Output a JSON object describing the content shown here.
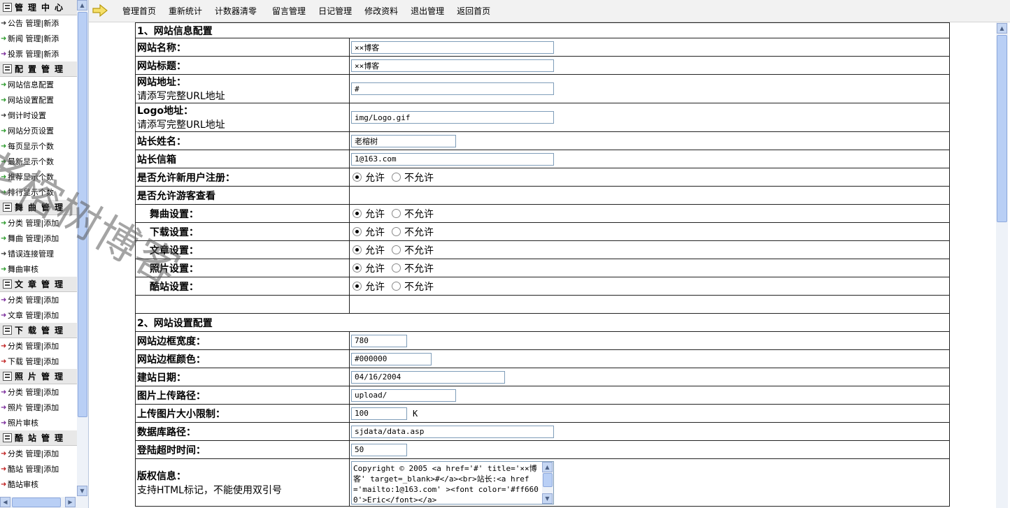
{
  "topbar": {
    "nav": [
      "管理首页",
      "重新统计",
      "计数器清零",
      "留言管理",
      "日记管理",
      "修改资料",
      "退出管理",
      "返回首页"
    ]
  },
  "sidebar": {
    "items": [
      {
        "type": "head",
        "label": "管理中心"
      },
      {
        "type": "item",
        "arrow": "blk",
        "label": "公告 管理|新添"
      },
      {
        "type": "item",
        "arrow": "grn",
        "label": "新闻 管理|新添"
      },
      {
        "type": "item",
        "arrow": "pur",
        "label": "投票 管理|新添"
      },
      {
        "type": "head",
        "label": "配置管理"
      },
      {
        "type": "item",
        "arrow": "grn",
        "label": "网站信息配置"
      },
      {
        "type": "item",
        "arrow": "grn",
        "label": "网站设置配置"
      },
      {
        "type": "item",
        "arrow": "blk",
        "label": "倒计时设置"
      },
      {
        "type": "item",
        "arrow": "grn",
        "label": "网站分页设置"
      },
      {
        "type": "item",
        "arrow": "grn",
        "label": "每页显示个数"
      },
      {
        "type": "item",
        "arrow": "grn",
        "label": "最新显示个数"
      },
      {
        "type": "item",
        "arrow": "grn",
        "label": "推荐显示个数"
      },
      {
        "type": "item",
        "arrow": "grn",
        "label": "排行显示个数"
      },
      {
        "type": "head",
        "label": "舞曲管理"
      },
      {
        "type": "item",
        "arrow": "grn",
        "label": "分类 管理|添加"
      },
      {
        "type": "item",
        "arrow": "grn",
        "label": "舞曲 管理|添加"
      },
      {
        "type": "item",
        "arrow": "blk",
        "label": "错误连接管理"
      },
      {
        "type": "item",
        "arrow": "grn",
        "label": "舞曲审核"
      },
      {
        "type": "head",
        "label": "文章管理"
      },
      {
        "type": "item",
        "arrow": "pur",
        "label": "分类 管理|添加"
      },
      {
        "type": "item",
        "arrow": "pur",
        "label": "文章 管理|添加"
      },
      {
        "type": "head",
        "label": "下载管理"
      },
      {
        "type": "item",
        "arrow": "red",
        "label": "分类 管理|添加"
      },
      {
        "type": "item",
        "arrow": "red",
        "label": "下载 管理|添加"
      },
      {
        "type": "head",
        "label": "照片管理"
      },
      {
        "type": "item",
        "arrow": "pur",
        "label": "分类 管理|添加"
      },
      {
        "type": "item",
        "arrow": "pur",
        "label": "照片 管理|添加"
      },
      {
        "type": "item",
        "arrow": "pur",
        "label": "照片审核"
      },
      {
        "type": "head",
        "label": "酷站管理"
      },
      {
        "type": "item",
        "arrow": "red",
        "label": "分类 管理|添加"
      },
      {
        "type": "item",
        "arrow": "red",
        "label": "酷站 管理|添加"
      },
      {
        "type": "item",
        "arrow": "red",
        "label": "酷站审核"
      }
    ]
  },
  "watermark": "老榕树博客",
  "form": {
    "rows": [
      {
        "type": "section",
        "label": "1、网站信息配置",
        "h": 22
      },
      {
        "type": "text",
        "label": "网站名称：",
        "value": "××博客",
        "w": 290,
        "h": 26
      },
      {
        "type": "text",
        "label": "网站标题：",
        "value": "××博客",
        "w": 290,
        "h": 26
      },
      {
        "type": "text",
        "label": "网站地址：",
        "sub": "请添写完整URL地址",
        "value": "#",
        "w": 290,
        "h": 41
      },
      {
        "type": "text",
        "label": "Logo地址：",
        "sub": "请添写完整URL地址",
        "value": "img/Logo.gif",
        "w": 290,
        "h": 41
      },
      {
        "type": "text",
        "label": "站长姓名：",
        "value": "老榕树",
        "w": 150,
        "h": 26
      },
      {
        "type": "text",
        "label": "站长信箱",
        "value": "1@163.com",
        "w": 290,
        "h": 26
      },
      {
        "type": "radio",
        "label": "是否允许新用户注册：",
        "checked": 0,
        "h": 26
      },
      {
        "type": "group",
        "label": "是否允许游客查看",
        "h": 26
      },
      {
        "type": "radio",
        "indent": true,
        "label": "舞曲设置：",
        "checked": 0,
        "h": 26
      },
      {
        "type": "radio",
        "indent": true,
        "label": "下载设置：",
        "checked": 0,
        "h": 26
      },
      {
        "type": "radio",
        "indent": true,
        "label": "文章设置：",
        "checked": 0,
        "h": 26
      },
      {
        "type": "radio",
        "indent": true,
        "label": "照片设置：",
        "checked": 0,
        "h": 26
      },
      {
        "type": "radio",
        "indent": true,
        "label": "酷站设置：",
        "checked": 0,
        "h": 26
      },
      {
        "type": "empty",
        "h": 26
      },
      {
        "type": "section",
        "label": "2、网站设置配置",
        "h": 26
      },
      {
        "type": "text",
        "label": "网站边框宽度：",
        "value": "780",
        "w": 80,
        "h": 26
      },
      {
        "type": "text",
        "label": "网站边框颜色：",
        "value": "#000000",
        "w": 115,
        "h": 26
      },
      {
        "type": "text",
        "label": "建站日期：",
        "value": "04/16/2004",
        "w": 220,
        "h": 26
      },
      {
        "type": "text",
        "label": "图片上传路径：",
        "value": "upload/",
        "w": 150,
        "h": 26
      },
      {
        "type": "text",
        "label": "上传图片大小限制：",
        "value": "100",
        "unit": "K",
        "w": 80,
        "h": 26
      },
      {
        "type": "text",
        "label": "数据库路径：",
        "value": "sjdata/data.asp",
        "w": 290,
        "h": 26
      },
      {
        "type": "text",
        "label": "登陆超时时间：",
        "value": "50",
        "w": 80,
        "h": 26
      },
      {
        "type": "textarea",
        "label": "版权信息：",
        "sub": "支持HTML标记，不能使用双引号",
        "value": "Copyright © 2005 <a href='#' title='××博客' target=_blank>#</a><br>站长:<a href='mailto:1@163.com' ><font color='#ff6600'>Eric</font></a>",
        "h": 68
      }
    ],
    "radio_options": [
      "允许",
      "不允许"
    ]
  }
}
